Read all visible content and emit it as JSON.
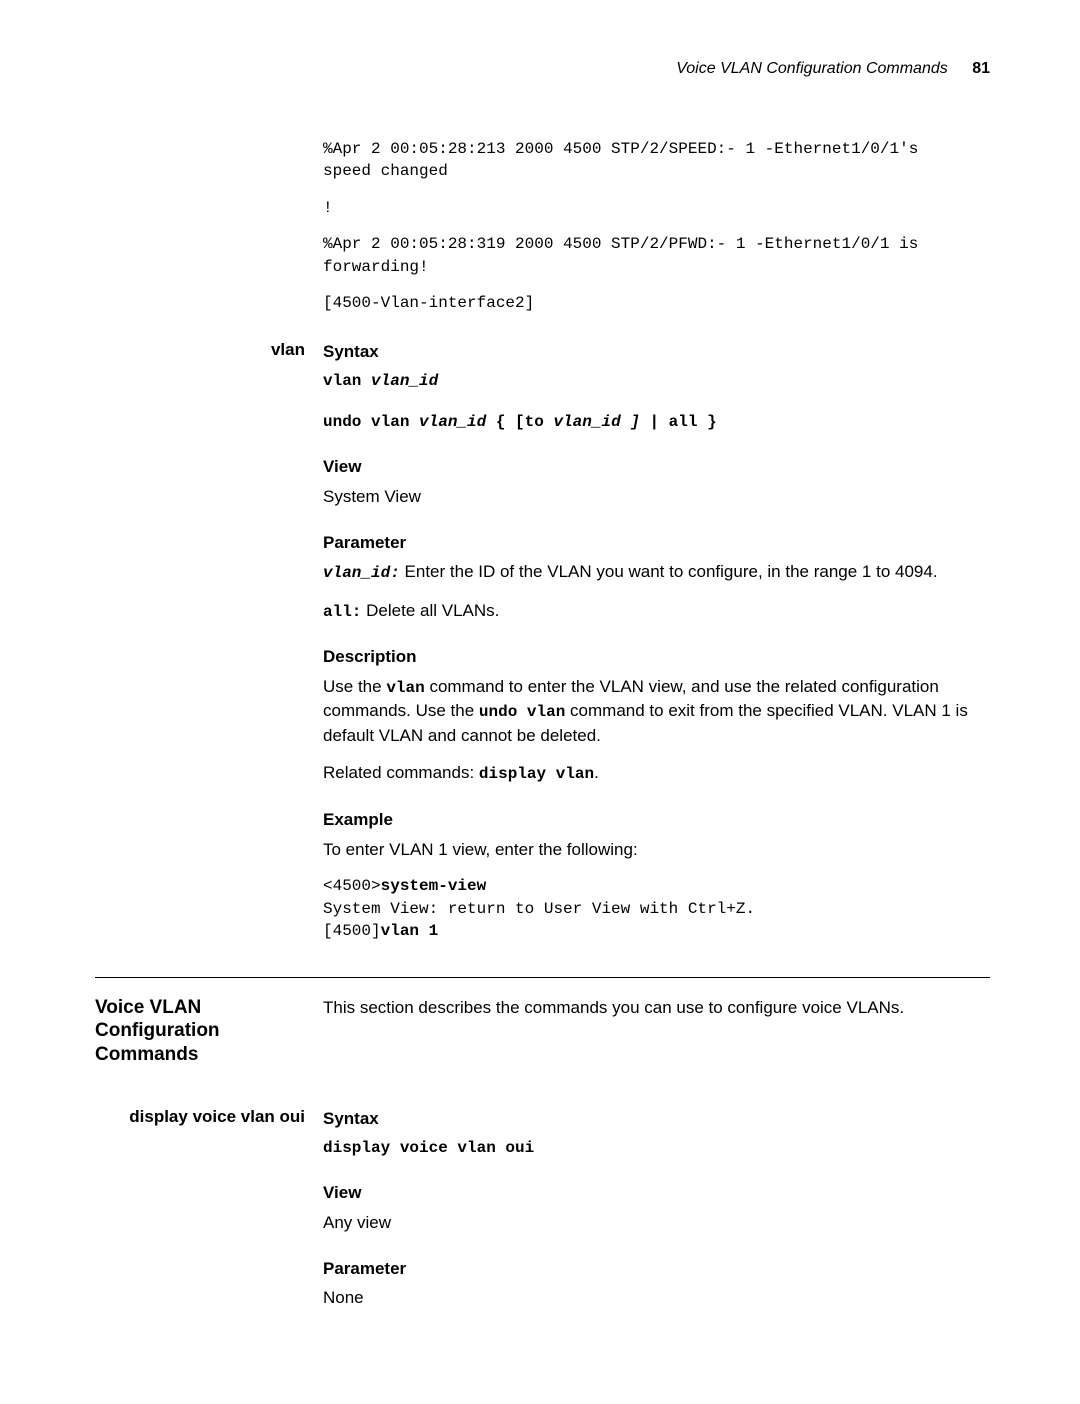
{
  "header": {
    "title": "Voice VLAN Configuration Commands",
    "page": "81"
  },
  "top_mono": {
    "l1": "%Apr  2 00:05:28:213 2000 4500 STP/2/SPEED:- 1 -Ethernet1/0/1's",
    "l2": "speed changed",
    "l3": "!",
    "l4": "%Apr  2 00:05:28:319 2000 4500 STP/2/PFWD:- 1 -Ethernet1/0/1 is",
    "l5": "forwarding!",
    "l6": "[4500-Vlan-interface2]"
  },
  "vlan_cmd": {
    "label": "vlan",
    "syntax_h": "Syntax",
    "syntax1_a": "vlan ",
    "syntax1_b": "vlan_id",
    "syntax2_a": "undo vlan ",
    "syntax2_b": "vlan_id",
    "syntax2_c": " { [to ",
    "syntax2_d": "vlan_id ]",
    "syntax2_e": " | all }",
    "view_h": "View",
    "view_t": "System View",
    "param_h": "Parameter",
    "param1_a": "vlan_id:",
    "param1_b": " Enter the ID of the VLAN you want to configure, in the range 1 to 4094.",
    "param2_a": "all:",
    "param2_b": " Delete all VLANs.",
    "desc_h": "Description",
    "desc_p1a": "Use the ",
    "desc_p1b": "vlan",
    "desc_p1c": " command to enter the VLAN view, and use the related configuration commands. Use the ",
    "desc_p1d": "undo vlan",
    "desc_p1e": " command to exit from the specified VLAN. VLAN 1 is default VLAN and cannot be deleted.",
    "desc_p2a": "Related commands: ",
    "desc_p2b": "display vlan",
    "desc_p2c": ".",
    "example_h": "Example",
    "example_t": "To enter VLAN 1 view, enter the following:",
    "ex_l1a": "<4500>",
    "ex_l1b": "system-view",
    "ex_l2": "System View: return to User View with Ctrl+Z.",
    "ex_l3a": "[4500]",
    "ex_l3b": "vlan 1"
  },
  "voice_section": {
    "title": "Voice VLAN Configuration Commands",
    "intro": "This section describes the commands you can use to configure voice VLANs."
  },
  "dvvo": {
    "label": "display voice vlan oui",
    "syntax_h": "Syntax",
    "syntax1": "display voice vlan oui",
    "view_h": "View",
    "view_t": "Any view",
    "param_h": "Parameter",
    "param_t": "None"
  }
}
